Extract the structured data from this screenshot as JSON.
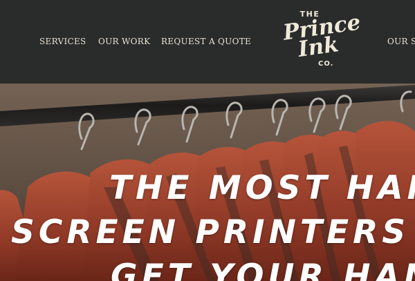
{
  "header": {
    "nav": {
      "services": "SERVICES",
      "our_work": "OUR WORK",
      "request_quote": "REQUEST A QUOTE",
      "our_story": "OUR ST"
    },
    "logo": {
      "the": "THE",
      "prince": "Prince",
      "ink": "Ink",
      "co": "CO."
    }
  },
  "hero": {
    "headline_lines": [
      "THE MOST HAND",
      "SCREEN PRINTERS YO",
      "GET YOUR HAND"
    ],
    "background": "clothing-rack-with-wooden-hangers"
  },
  "colors": {
    "header_bg": "#2a2b2b",
    "nav_text": "#e8e3d6",
    "logo": "#efe9da",
    "hanger_wood": "#9a3e2c",
    "headline": "#ffffff"
  }
}
